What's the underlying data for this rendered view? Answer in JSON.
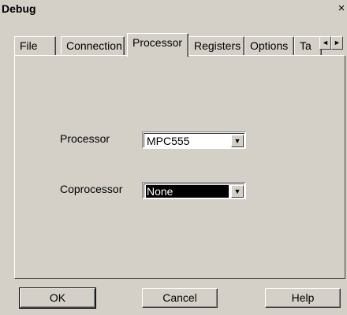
{
  "window": {
    "title": "Debug",
    "close_glyph": "×"
  },
  "tabs": [
    {
      "label": "File",
      "active": false
    },
    {
      "label": "Connection",
      "active": false
    },
    {
      "label": "Processor",
      "active": true
    },
    {
      "label": "Registers",
      "active": false
    },
    {
      "label": "Options",
      "active": false
    },
    {
      "label": "Ta",
      "active": false
    }
  ],
  "tab_scroll": {
    "left_glyph": "◄",
    "right_glyph": "►"
  },
  "fields": {
    "processor": {
      "label": "Processor",
      "value": "MPC555"
    },
    "coprocessor": {
      "label": "Coprocessor",
      "value": "None"
    }
  },
  "combo_arrow_glyph": "▼",
  "buttons": {
    "ok": "OK",
    "cancel": "Cancel",
    "help": "Help"
  },
  "colors": {
    "face": "#d4d0c8",
    "highlight": "#ffffff",
    "shadow": "#808080",
    "dark_shadow": "#404040",
    "selection": "#000000"
  }
}
